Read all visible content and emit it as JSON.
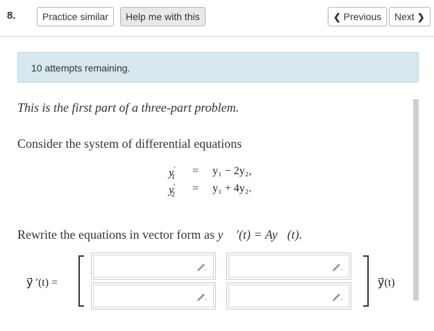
{
  "question_number": "8.",
  "buttons": {
    "practice_similar": "Practice similar",
    "help_me": "Help me with this",
    "previous": "Previous",
    "next": "Next"
  },
  "notice": "10 attempts remaining.",
  "problem": {
    "intro": "This is the first part of a three-part problem.",
    "consider": "Consider the system of differential equations",
    "equations": [
      {
        "lhs_var": "y",
        "lhs_sub": "1",
        "prime": "′",
        "eq": "=",
        "rhs": "y₁ − 2y₂,"
      },
      {
        "lhs_var": "y",
        "lhs_sub": "2",
        "prime": "′",
        "eq": "=",
        "rhs": "y₁ + 4y₂."
      }
    ],
    "rewrite_prefix": "Rewrite the equations in vector form as",
    "rewrite_formula": "y⃗ ′(t) = Ay⃗(t).",
    "lhs_label": "y⃗ ′(t) =",
    "rhs_label": "y⃗(t)"
  },
  "matrix_inputs": [
    {
      "row": 1,
      "col": 1,
      "value": ""
    },
    {
      "row": 1,
      "col": 2,
      "value": ""
    },
    {
      "row": 2,
      "col": 1,
      "value": ""
    },
    {
      "row": 2,
      "col": 2,
      "value": ""
    }
  ],
  "colors": {
    "notice_bg": "#d7e8ef",
    "help_bg": "#e8e8e8",
    "divider": "#cfcfcf"
  }
}
